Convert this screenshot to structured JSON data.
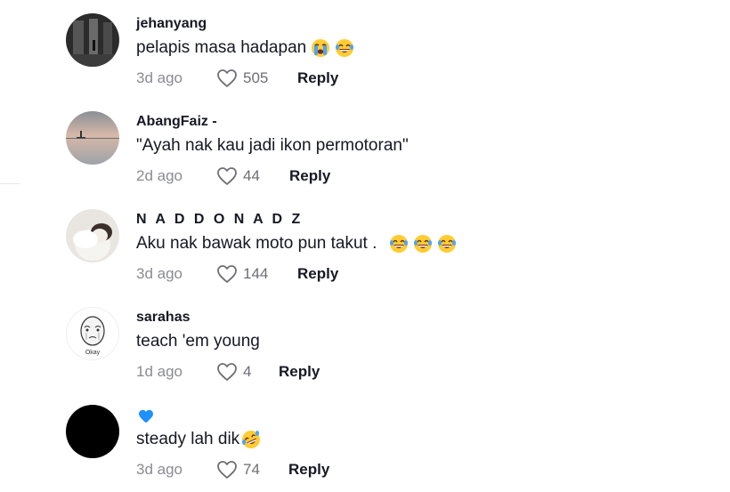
{
  "comments": [
    {
      "username": "jehanyang",
      "text": "pelapis masa hadapan",
      "emojis": [
        "loudly-crying-face",
        "tears-of-joy"
      ],
      "date": "3d ago",
      "likes": "505",
      "reply_label": "Reply"
    },
    {
      "username": "AbangFaiz -",
      "text": "\"Ayah nak kau jadi ikon permotoran\"",
      "emojis": [],
      "date": "2d ago",
      "likes": "44",
      "reply_label": "Reply"
    },
    {
      "username": "N A D D O N A D Z",
      "text": "Aku nak bawak moto pun takut .",
      "emojis": [
        "tears-of-joy",
        "tears-of-joy",
        "tears-of-joy"
      ],
      "date": "3d ago",
      "likes": "144",
      "reply_label": "Reply"
    },
    {
      "username": "sarahas",
      "text": "teach 'em young",
      "emojis": [],
      "date": "1d ago",
      "likes": "4",
      "reply_label": "Reply",
      "avatar_caption": "Okay"
    },
    {
      "username": "",
      "username_icon": "blue-heart-emoji",
      "text": "steady lah dik",
      "emojis": [
        "rolling-on-floor-laughing"
      ],
      "date": "3d ago",
      "likes": "74",
      "reply_label": "Reply"
    }
  ],
  "colors": {
    "text": "#161823",
    "meta": "#8a8b91",
    "heart_outline": "#6d6e75",
    "blue_heart": "#1e90ff"
  }
}
